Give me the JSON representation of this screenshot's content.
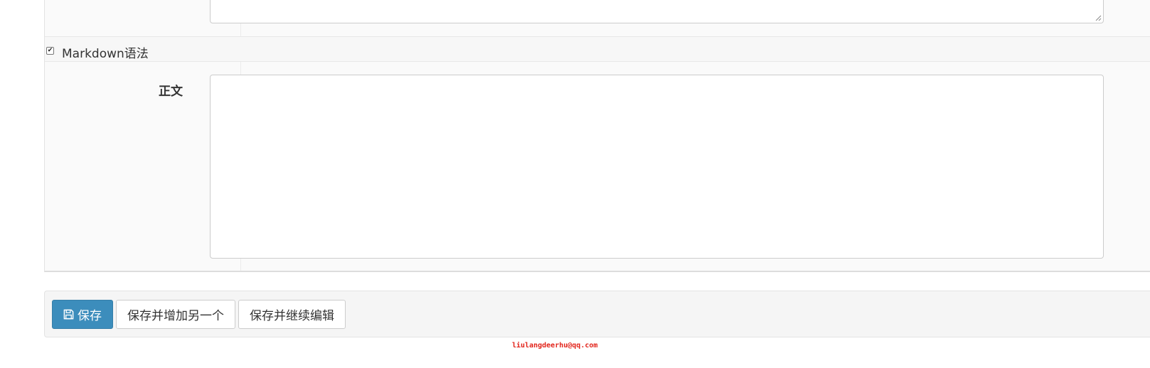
{
  "form": {
    "markdown_label": "Markdown语法",
    "markdown_checked": true,
    "body_label": "正文",
    "body_value": ""
  },
  "actions": {
    "save_label": "保存",
    "save_add_label": "保存并增加另一个",
    "save_continue_label": "保存并继续编辑",
    "primary_color": "#3c8dbc"
  },
  "icons": {
    "save": "floppy-disk-icon"
  },
  "watermark": {
    "text": "liulangdeerhu@qq.com",
    "color": "#e2231a"
  }
}
